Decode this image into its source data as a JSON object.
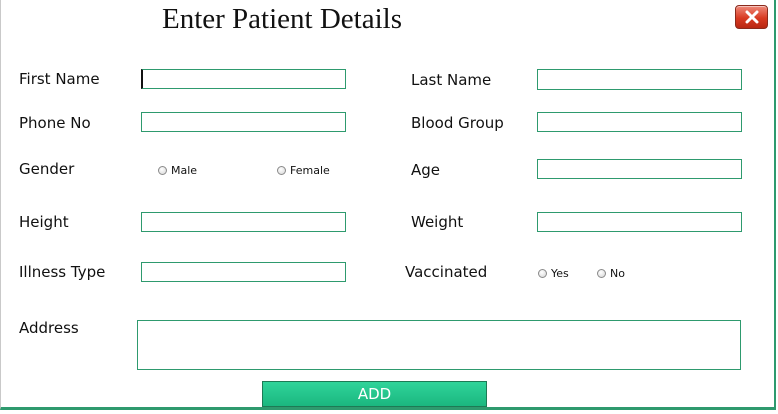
{
  "title": "Enter Patient Details",
  "fields": {
    "first_name": {
      "label": "First Name",
      "value": ""
    },
    "last_name": {
      "label": "Last Name",
      "value": ""
    },
    "phone_no": {
      "label": "Phone No",
      "value": ""
    },
    "blood_group": {
      "label": "Blood Group",
      "value": ""
    },
    "gender": {
      "label": "Gender",
      "options": [
        "Male",
        "Female"
      ]
    },
    "age": {
      "label": "Age",
      "value": ""
    },
    "height": {
      "label": "Height",
      "value": ""
    },
    "weight": {
      "label": "Weight",
      "value": ""
    },
    "illness_type": {
      "label": "Illness Type",
      "value": ""
    },
    "vaccinated": {
      "label": "Vaccinated",
      "options": [
        "Yes",
        "No"
      ]
    },
    "address": {
      "label": "Address",
      "value": ""
    }
  },
  "buttons": {
    "add_label": "ADD"
  },
  "icons": {
    "close": "close-icon"
  },
  "colors": {
    "field_border": "#2e9a6e",
    "add_button": "#1bb77f",
    "close_button": "#d83a22"
  }
}
